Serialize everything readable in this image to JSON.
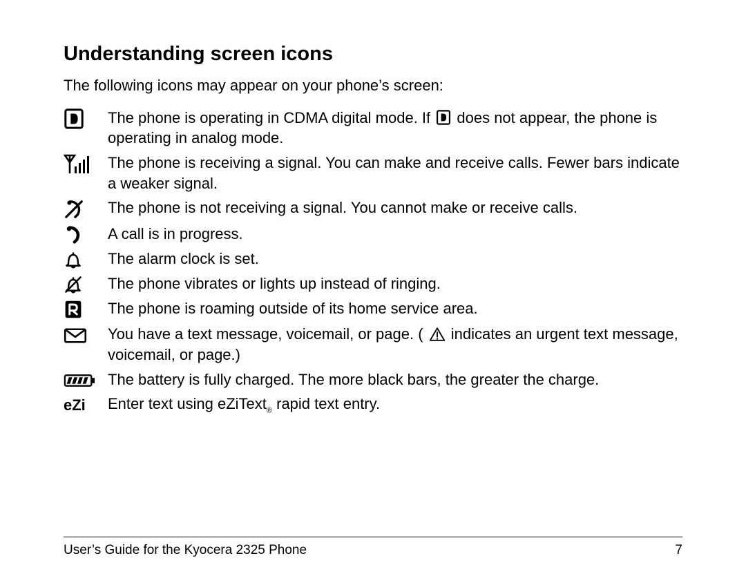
{
  "heading": "Understanding screen icons",
  "intro": "The following icons may appear on your phone’s screen:",
  "rows": [
    {
      "icon": "digital-mode-icon",
      "desc_before": "The phone is operating in CDMA digital mode. If ",
      "inline_icon": "digital-mode-icon",
      "desc_after": " does not appear, the phone is operating in analog mode."
    },
    {
      "icon": "signal-bars-icon",
      "desc": "The phone is receiving a signal. You can make and receive calls. Fewer bars indicate a weaker signal."
    },
    {
      "icon": "no-signal-icon",
      "desc": "The phone is not receiving a signal. You cannot make or receive calls."
    },
    {
      "icon": "call-in-progress-icon",
      "desc": "A call is in progress."
    },
    {
      "icon": "alarm-icon",
      "desc": "The alarm clock is set."
    },
    {
      "icon": "vibrate-icon",
      "desc": "The phone vibrates or lights up instead of ringing."
    },
    {
      "icon": "roaming-icon",
      "desc": "The phone is roaming outside of its home service area."
    },
    {
      "icon": "message-icon",
      "desc_before": "You have a text message, voicemail, or page. ( ",
      "inline_icon": "urgent-icon",
      "desc_after": " indicates an urgent text message, voicemail, or page.)"
    },
    {
      "icon": "battery-icon",
      "desc": "The battery is fully charged. The more black bars, the greater the charge."
    },
    {
      "icon": "ezi-icon",
      "desc_before": "Enter text using eZiText",
      "inline_text": "®",
      "desc_after": " rapid text entry."
    }
  ],
  "icon_glyph": {
    "ezi-icon": "eZi"
  },
  "footer": {
    "left": "User’s Guide for the Kyocera 2325 Phone",
    "right": "7"
  }
}
